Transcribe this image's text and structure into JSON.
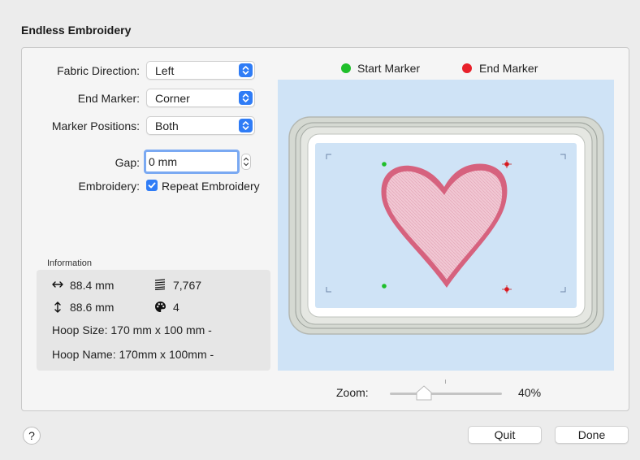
{
  "dialog": {
    "title": "Endless Embroidery"
  },
  "settings": {
    "fabric_direction": {
      "label": "Fabric Direction:",
      "value": "Left"
    },
    "end_marker": {
      "label": "End Marker:",
      "value": "Corner"
    },
    "marker_positions": {
      "label": "Marker Positions:",
      "value": "Both"
    },
    "gap": {
      "label": "Gap:",
      "value": "0 mm"
    },
    "embroidery": {
      "label": "Embroidery:",
      "checkbox_label": "Repeat Embroidery",
      "checked": true
    }
  },
  "information": {
    "heading": "Information",
    "width": "88.4 mm",
    "height": "88.6 mm",
    "stitches": "7,767",
    "colors": "4",
    "hoop_size": "Hoop Size: 170 mm x 100 mm -",
    "hoop_name": "Hoop Name: 170mm x 100mm -"
  },
  "legend": {
    "start": {
      "label": "Start Marker",
      "color": "#1fbf2a"
    },
    "end": {
      "label": "End Marker",
      "color": "#e8202a"
    }
  },
  "zoom": {
    "label": "Zoom:",
    "value": "40%",
    "level_percent": 40
  },
  "buttons": {
    "help": "?",
    "quit": "Quit",
    "done": "Done"
  }
}
